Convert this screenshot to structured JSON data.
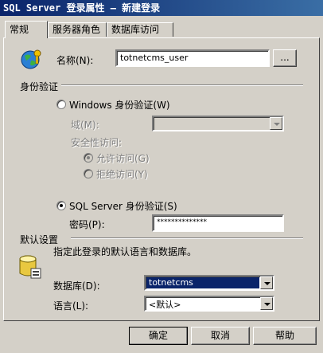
{
  "window": {
    "title": "SQL Server 登录属性 — 新建登录"
  },
  "tabs": [
    {
      "label": "常规"
    },
    {
      "label": "服务器角色"
    },
    {
      "label": "数据库访问"
    }
  ],
  "general": {
    "name_label": "名称(N):",
    "name_value": "totnetcms_user",
    "browse_label": "...",
    "auth_group": "身份验证",
    "windows_auth": "Windows 身份验证(W)",
    "domain_label": "域(M):",
    "security_access_label": "安全性访问:",
    "allow_access": "允许访问(G)",
    "deny_access": "拒绝访问(Y)",
    "sql_auth": "SQL Server 身份验证(S)",
    "password_label": "密码(P):",
    "password_value": "**************",
    "defaults_group": "默认设置",
    "defaults_desc": "指定此登录的默认语言和数据库。",
    "database_label": "数据库(D):",
    "database_value": "totnetcms",
    "language_label": "语言(L):",
    "language_value": "<默认>"
  },
  "buttons": {
    "ok": "确定",
    "cancel": "取消",
    "help": "帮助"
  },
  "icons": {
    "login": "globe-keys-icon",
    "database": "database-icon"
  }
}
